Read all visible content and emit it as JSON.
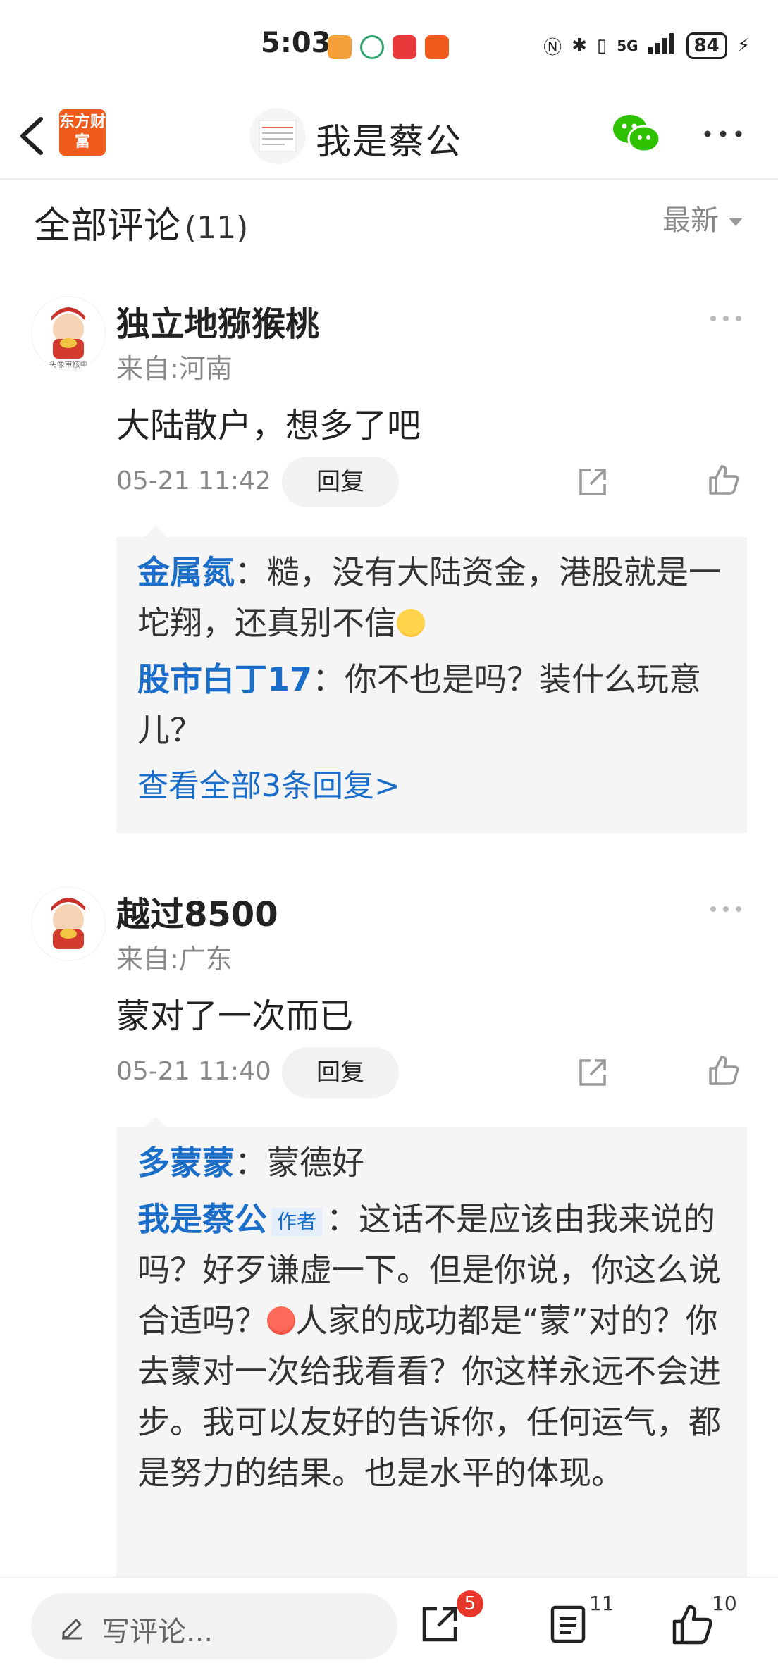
{
  "status_bar": {
    "time": "5:03",
    "network": "5G",
    "battery": "84"
  },
  "header": {
    "logo_text": "东方财富",
    "title": "我是蔡公"
  },
  "comments_section": {
    "title": "全部评论",
    "count": "(11)",
    "sort_label": "最新"
  },
  "comments": [
    {
      "username": "独立地猕猴桃",
      "location": "来自:河南",
      "text": "大陆散户，想多了吧",
      "time": "05-21 11:42",
      "reply_label": "回复",
      "replies": [
        {
          "name": "金属氮",
          "text": "：糙，没有大陆资金，港股就是一坨翔，还真别不信"
        },
        {
          "name": "股市白丁17",
          "text": "：你不也是吗？装什么玩意儿？"
        }
      ],
      "view_all": "查看全部3条回复>"
    },
    {
      "username": "越过8500",
      "location": "来自:广东",
      "text": "蒙对了一次而已",
      "time": "05-21 11:40",
      "reply_label": "回复",
      "replies": [
        {
          "name": "多蒙蒙",
          "text": "：蒙德好"
        },
        {
          "name": "我是蔡公",
          "tag": "作者",
          "text_a": "：这话不是应该由我来说的吗？好歹谦虚一下。但是你说，你这么说合适吗？",
          "text_b": "人家的成功都是“蒙”对的？你去蒙对一次给我看看？你这样永远不会进步。我可以友好的告诉你，任何运气，都是努力的结果。也是水平的体现。"
        }
      ]
    }
  ],
  "bottom_bar": {
    "write_placeholder": "写评论...",
    "share_badge": "5",
    "comment_count": "11",
    "like_count": "10"
  },
  "colors": {
    "accent_blue": "#1a6ec9",
    "brand_orange": "#f05a1a",
    "badge_red": "#e8362b"
  },
  "icons": [
    "back-icon",
    "wechat-icon",
    "more-icon",
    "share-icon",
    "like-icon",
    "pen-icon",
    "comment-list-icon"
  ]
}
